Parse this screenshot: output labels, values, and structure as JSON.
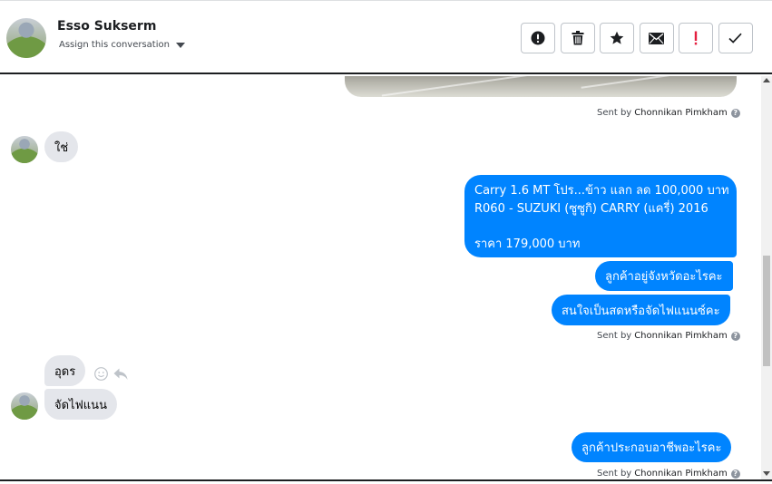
{
  "header": {
    "contact_name": "Esso Sukserm",
    "assign_label": "Assign this conversation",
    "actions": [
      "alert-icon",
      "trash-icon",
      "star-icon",
      "mail-icon",
      "exclamation-icon",
      "check-icon"
    ]
  },
  "sent_by": {
    "prefix": "Sent by",
    "agent": "Chonnikan Pimkham"
  },
  "messages": {
    "in_1": "ใช่",
    "out_offer": {
      "line1": "Carry 1.6 MT โปร...ข้าว แลก ลด 100,000 บาท",
      "line2": "R060 - SUZUKI (ซูซูกิ) CARRY (แครี่) 2016",
      "line3": "",
      "line4": "ราคา 179,000 บาท"
    },
    "out_2": "ลูกค้าอยู่จังหวัดอะไรคะ",
    "out_3": "สนใจเป็นสดหรือจัดไฟแนนซ์คะ",
    "in_2": "อุดร",
    "in_3": "จัดไฟแนน",
    "out_4": "ลูกค้าประกอบอาชีพอะไรคะ"
  },
  "colors": {
    "outgoing": "#0084ff",
    "incoming": "#e4e6eb"
  }
}
